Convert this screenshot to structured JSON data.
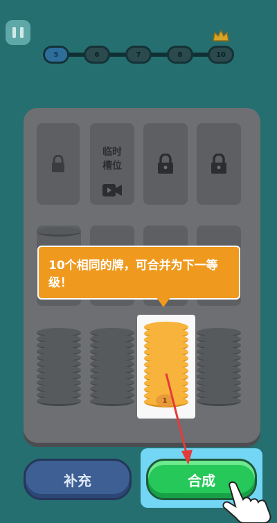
{
  "levels": [
    "5",
    "6",
    "7",
    "8",
    "10"
  ],
  "current_level": "5",
  "locked_slot": {
    "label_line1": "临时",
    "label_line2": "槽位"
  },
  "tooltip": "10个相同的牌，可合并为下一等级！",
  "highlight_badge": "1",
  "buttons": {
    "refill": "补充",
    "merge": "合成"
  },
  "icons": [
    "pause-icon",
    "lock-icon",
    "video-icon",
    "crown-icon",
    "hand-pointer-icon",
    "arrow-icon"
  ]
}
